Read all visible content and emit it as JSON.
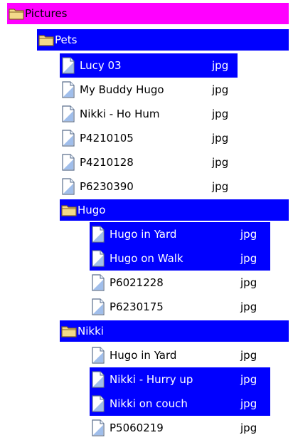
{
  "tree": {
    "root": {
      "label": "Pictures"
    },
    "pets": {
      "label": "Pets",
      "files": [
        {
          "name": "Lucy 03",
          "ext": "jpg",
          "selected": true
        },
        {
          "name": "My Buddy Hugo",
          "ext": "jpg",
          "selected": false
        },
        {
          "name": "Nikki - Ho Hum",
          "ext": "jpg",
          "selected": false
        },
        {
          "name": "P4210105",
          "ext": "jpg",
          "selected": false
        },
        {
          "name": "P4210128",
          "ext": "jpg",
          "selected": false
        },
        {
          "name": "P6230390",
          "ext": "jpg",
          "selected": false
        }
      ],
      "hugo": {
        "label": "Hugo",
        "files": [
          {
            "name": "Hugo in Yard",
            "ext": "jpg",
            "selected": true
          },
          {
            "name": "Hugo on Walk",
            "ext": "jpg",
            "selected": true
          },
          {
            "name": "P6021228",
            "ext": "jpg",
            "selected": false
          },
          {
            "name": "P6230175",
            "ext": "jpg",
            "selected": false
          }
        ]
      },
      "nikki": {
        "label": "Nikki",
        "files": [
          {
            "name": "Hugo in Yard",
            "ext": "jpg",
            "selected": false
          },
          {
            "name": "Nikki - Hurry up",
            "ext": "jpg",
            "selected": true
          },
          {
            "name": "Nikki on couch",
            "ext": "jpg",
            "selected": true
          },
          {
            "name": "P5060219",
            "ext": "jpg",
            "selected": false
          }
        ]
      }
    }
  },
  "colors": {
    "root_highlight": "#ff00ff",
    "selection": "#0000ff",
    "folder_fill": "#f3d98a",
    "folder_stroke": "#806020",
    "file_fill": "#ffffff",
    "file_accent": "#5a8fd8"
  },
  "icons": {
    "folder": "folder-icon",
    "file": "image-file-icon"
  }
}
